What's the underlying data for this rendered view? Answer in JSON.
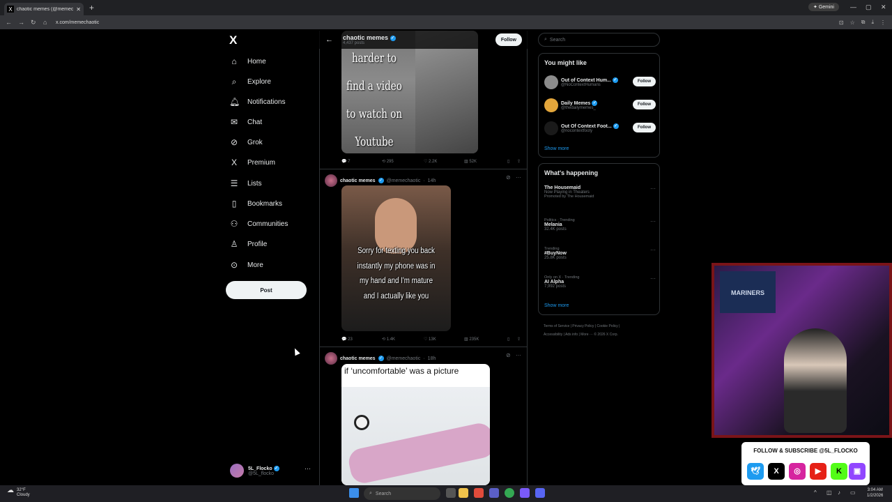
{
  "browser": {
    "tab_title": "chaotic memes (@memecha...",
    "url": "x.com/memechaotic",
    "gemini_label": "Gemini"
  },
  "nav": {
    "logo": "X",
    "items": [
      {
        "label": "Home",
        "icon": "home-icon"
      },
      {
        "label": "Explore",
        "icon": "search-icon"
      },
      {
        "label": "Notifications",
        "icon": "bell-icon"
      },
      {
        "label": "Chat",
        "icon": "mail-icon"
      },
      {
        "label": "Grok",
        "icon": "grok-icon"
      },
      {
        "label": "Premium",
        "icon": "x-icon"
      },
      {
        "label": "Lists",
        "icon": "list-icon"
      },
      {
        "label": "Bookmarks",
        "icon": "bookmark-icon"
      },
      {
        "label": "Communities",
        "icon": "people-icon"
      },
      {
        "label": "Profile",
        "icon": "person-icon"
      },
      {
        "label": "More",
        "icon": "more-circle-icon"
      }
    ],
    "post_label": "Post",
    "account": {
      "name": "5L_Flocko",
      "handle": "@5L_flocko"
    }
  },
  "profile_header": {
    "name": "chaotic memes",
    "posts": "4,437 posts",
    "follow_label": "Follow"
  },
  "tweets": [
    {
      "meme_text": "harder to find a video to watch on Youtube while eating",
      "replies": "7",
      "reposts": "295",
      "likes": "2.2K",
      "views": "52K"
    },
    {
      "name": "chaotic memes",
      "handle": "@memechaotic",
      "time": "14h",
      "meme_text": "Sorry for texting you back instantly my phone was in my hand and I'm mature and I actually like you",
      "replies": "23",
      "reposts": "1.4K",
      "likes": "13K",
      "views": "235K"
    },
    {
      "name": "chaotic memes",
      "handle": "@memechaotic",
      "time": "18h",
      "meme_text": "if ‘uncomfortable’ was a picture"
    }
  ],
  "search": {
    "placeholder": "Search"
  },
  "might_like": {
    "title": "You might like",
    "accounts": [
      {
        "name": "Out of Context Hum...",
        "handle": "@NoContextHumans",
        "follow": "Follow",
        "color": "#8c8c8c"
      },
      {
        "name": "Daily Memes",
        "handle": "@thedailymemes_",
        "follow": "Follow",
        "color": "#e3a63b"
      },
      {
        "name": "Out Of Context Foot...",
        "handle": "@nocontextfooty",
        "follow": "Follow",
        "color": "#1a1a1a"
      }
    ],
    "show_more": "Show more"
  },
  "happening": {
    "title": "What's happening",
    "trends": [
      {
        "context": "",
        "title": "The Housemaid",
        "sub": "Now Playing in Theaters",
        "extra": "Promoted by The Housemaid"
      },
      {
        "context": "Politics · Trending",
        "title": "Melania",
        "sub": "32.4K posts",
        "extra": ""
      },
      {
        "context": "Trending",
        "title": "#BuyNow",
        "sub": "25.8K posts",
        "extra": ""
      },
      {
        "context": "Only on X · Trending",
        "title": "AI Alpha",
        "sub": "7,992 posts",
        "extra": ""
      }
    ],
    "show_more": "Show more"
  },
  "footer": {
    "line1": "Terms of Service  |  Privacy Policy  |  Cookie Policy  |",
    "line2": "Accessibility  |  Ads info  |  More ···  © 2026 X Corp."
  },
  "stream": {
    "banner": "MARINERS",
    "subscribe": "FOLLOW & SUBSCRIBE @5L_FLOCKO"
  },
  "taskbar": {
    "temp": "32°F",
    "weather": "Cloudy",
    "search": "Search",
    "time": "3:04 AM",
    "date": "1/2/2026"
  }
}
